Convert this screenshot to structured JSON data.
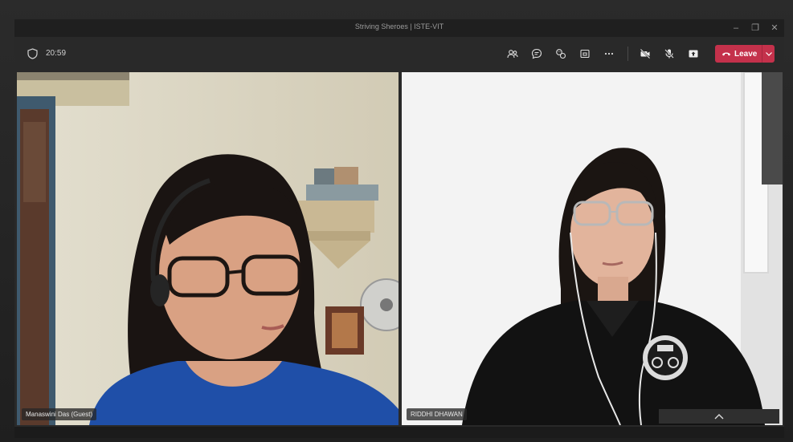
{
  "window": {
    "title": "Striving Sheroes | ISTE-VIT"
  },
  "toolbar": {
    "timer": "20:59",
    "leave_label": "Leave",
    "buttons": [
      "people-icon",
      "chat-icon",
      "reactions-icon",
      "share-tray-icon",
      "more-icon",
      "camera-off-icon",
      "mic-off-icon",
      "share-icon"
    ]
  },
  "participants": [
    {
      "name": "Manaswini Das (Guest)"
    },
    {
      "name": "RIDDHI DHAWAN"
    }
  ],
  "colors": {
    "leave": "#c4314b",
    "background": "#292929"
  }
}
